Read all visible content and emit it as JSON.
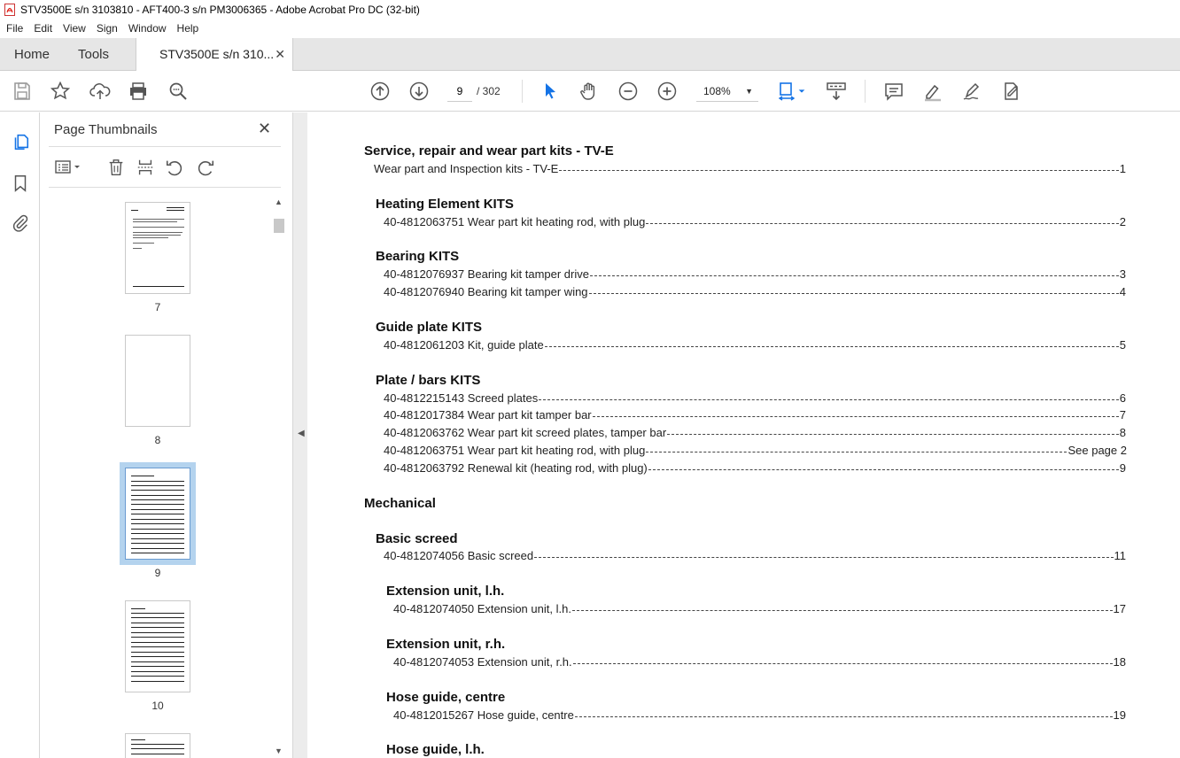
{
  "window": {
    "title": "STV3500E s/n 3103810 - AFT400-3 s/n PM3006365 - Adobe Acrobat Pro DC (32-bit)"
  },
  "menu": [
    "File",
    "Edit",
    "View",
    "Sign",
    "Window",
    "Help"
  ],
  "tabs": {
    "home": "Home",
    "tools": "Tools",
    "document": "STV3500E s/n 310..."
  },
  "toolbar": {
    "page_current": "9",
    "page_total": "/ 302",
    "zoom": "108%"
  },
  "thumbnails": {
    "title": "Page Thumbnails",
    "pages": [
      "7",
      "8",
      "9",
      "10"
    ],
    "selected": "9"
  },
  "toc": {
    "sec1": "Service, repair and wear part kits - TV-E",
    "sec1_item": {
      "label": "Wear part and Inspection kits - TV-E",
      "page": "1"
    },
    "heating_head": "Heating Element KITS",
    "heating_1": {
      "label": "40-4812063751 Wear part kit heating rod, with plug",
      "page": "2"
    },
    "bearing_head": "Bearing KITS",
    "bearing_1": {
      "label": "40-4812076937 Bearing kit tamper drive",
      "page": "3"
    },
    "bearing_2": {
      "label": "40-4812076940 Bearing kit tamper wing",
      "page": "4"
    },
    "guide_head": "Guide plate KITS",
    "guide_1": {
      "label": "40-4812061203 Kit, guide plate",
      "page": "5"
    },
    "plate_head": "Plate / bars KITS",
    "plate_1": {
      "label": "40-4812215143 Screed plates",
      "page": "6"
    },
    "plate_2": {
      "label": "40-4812017384 Wear part kit tamper bar",
      "page": "7"
    },
    "plate_3": {
      "label": "40-4812063762 Wear part kit screed plates, tamper bar",
      "page": "8"
    },
    "plate_4": {
      "label": "40-4812063751 Wear part kit heating rod, with plug",
      "page": "See page 2"
    },
    "plate_5": {
      "label": "40-4812063792 Renewal kit (heating rod, with plug)",
      "page": "9"
    },
    "sec2": "Mechanical",
    "basic_head": "Basic screed",
    "basic_1": {
      "label": "40-4812074056 Basic screed",
      "page": "11"
    },
    "extl_head": "Extension unit, l.h.",
    "extl_1": {
      "label": "40-4812074050 Extension unit, l.h.",
      "page": "17"
    },
    "extr_head": "Extension unit, r.h.",
    "extr_1": {
      "label": "40-4812074053 Extension unit, r.h.",
      "page": "18"
    },
    "hosec_head": "Hose guide, centre",
    "hosec_1": {
      "label": "40-4812015267 Hose guide, centre",
      "page": "19"
    },
    "hosel_head": "Hose guide, l.h."
  },
  "colors": {
    "accent_blue": "#1473e6",
    "selection": "#b4d3ee",
    "acrobat_red": "#e3241b"
  }
}
